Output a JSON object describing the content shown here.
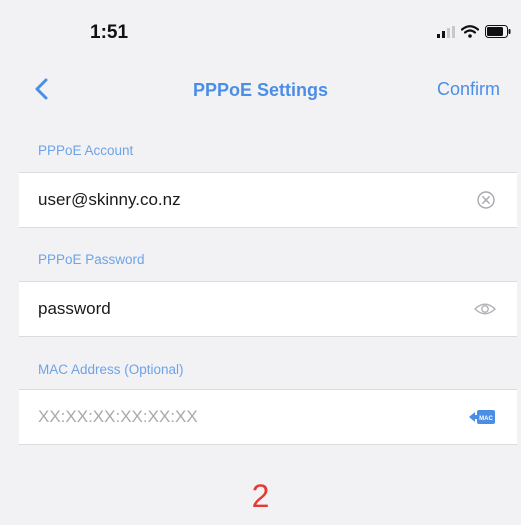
{
  "status_bar": {
    "time": "1:51",
    "icons": [
      "signal-icon",
      "wifi-icon",
      "battery-icon"
    ]
  },
  "nav": {
    "back_icon": "chevron-left-icon",
    "title": "PPPoE Settings",
    "confirm_label": "Confirm"
  },
  "form": {
    "account": {
      "label": "PPPoE Account",
      "value": "user@skinny.co.nz",
      "action_icon": "clear-icon"
    },
    "password": {
      "label": "PPPoE Password",
      "value": "password",
      "action_icon": "eye-icon"
    },
    "mac": {
      "label": "MAC Address (Optional)",
      "value": "",
      "placeholder": "XX:XX:XX:XX:XX:XX",
      "action_icon": "mac-clone-icon",
      "action_icon_text": "MAC"
    }
  },
  "page_number": "2",
  "colors": {
    "accent": "#4a8ee6",
    "label": "#6ea3e6",
    "background": "#f2f2f5",
    "row_background": "#ffffff",
    "page_number": "#e53935"
  }
}
